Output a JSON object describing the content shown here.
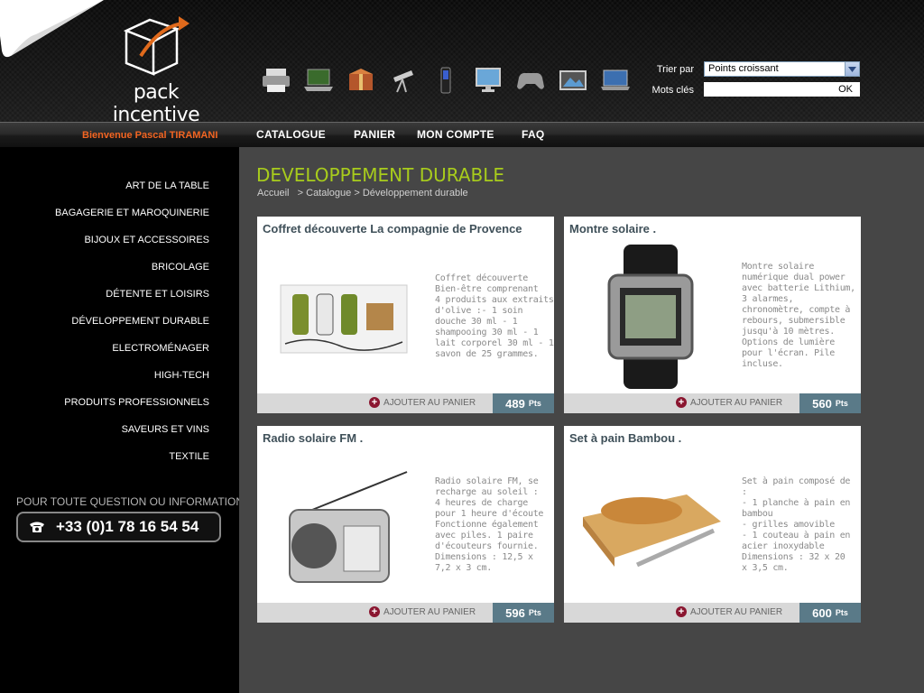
{
  "header": {
    "logo_text": "pack incentive",
    "category_icons": [
      "printer-icon",
      "laptop-icon",
      "gift-box-icon",
      "telescope-icon",
      "mp3-player-icon",
      "monitor-icon",
      "gamepad-icon",
      "photo-frame-icon",
      "notebook-icon"
    ],
    "sort_label": "Trier par",
    "sort_value": "Points croissant",
    "keywords_label": "Mots clés",
    "search_button": "OK"
  },
  "nav": {
    "welcome": "Bienvenue Pascal TIRAMANI",
    "items": [
      "CATALOGUE",
      "PANIER",
      "MON COMPTE",
      "FAQ"
    ]
  },
  "sidebar": {
    "items": [
      "ART DE LA TABLE",
      "BAGAGERIE ET MAROQUINERIE",
      "BIJOUX ET ACCESSOIRES",
      "BRICOLAGE",
      "DÉTENTE ET LOISIRS",
      "DÉVELOPPEMENT DURABLE",
      "ELECTROMÉNAGER",
      "HIGH-TECH",
      "PRODUITS PROFESSIONNELS",
      "SAVEURS ET VINS",
      "TEXTILE"
    ],
    "contact_label": "POUR TOUTE QUESTION OU INFORMATION",
    "phone": "+33 (0)1 78 16 54 54"
  },
  "main": {
    "title": "DEVELOPPEMENT DURABLE",
    "breadcrumb": [
      "Accueil",
      "Catalogue",
      "Développement durable"
    ],
    "add_label": "AJOUTER AU PANIER",
    "pts_label": "Pts",
    "products": [
      {
        "title": "Coffret découverte La compagnie de Provence",
        "desc": "Coffret découverte\nBien-être comprenant\n4 produits aux extraits\nd'olive :- 1 soin\ndouche 30 ml - 1\nshampooing 30 ml - 1\nlait corporel 30 ml - 1\nsavon de 25 grammes.",
        "price": "489"
      },
      {
        "title": "Montre solaire .",
        "desc": "Montre solaire\nnumérique dual power\navec batterie Lithium,\n3 alarmes,\nchronomètre, compte à\nrebours, submersible\njusqu'à 10 mètres.\nOptions de lumière\npour l'écran. Pile\nincluse.",
        "price": "560"
      },
      {
        "title": "Radio solaire FM .",
        "desc": "Radio solaire FM, se\nrecharge au soleil :\n4 heures de charge\npour 1 heure d'écoute\nFonctionne également\navec piles. 1 paire\nd'écouteurs fournie.\nDimensions : 12,5 x\n7,2 x 3 cm.",
        "price": "596"
      },
      {
        "title": "Set à pain Bambou .",
        "desc": "Set à pain composé de\n:\n- 1 planche à pain en\nbambou\n- grilles amovible\n- 1 couteau à pain en\nacier inoxydable\nDimensions : 32 x 20\nx 3,5 cm.",
        "price": "600"
      }
    ]
  }
}
